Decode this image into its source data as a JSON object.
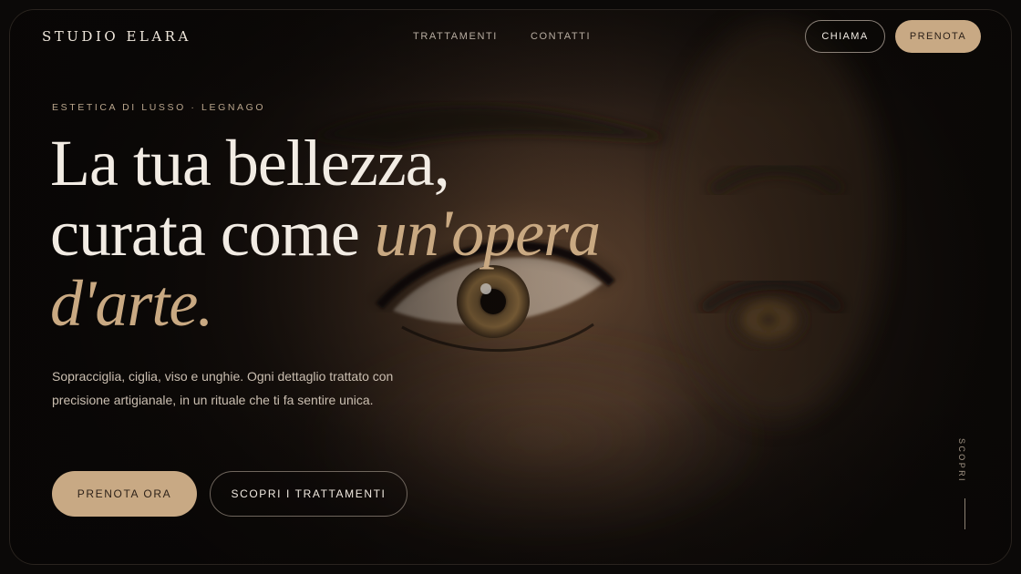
{
  "brand": {
    "name": "STUDIO ELARA"
  },
  "nav": {
    "links": [
      "TRATTAMENTI",
      "CONTATTI"
    ],
    "call_label": "CHIAMA",
    "book_label": "PRENOTA"
  },
  "hero": {
    "eyebrow": "ESTETICA DI LUSSO · LEGNAGO",
    "headline_line1": "La tua bellezza,",
    "headline_line2_plain": "curata come ",
    "headline_line2_accent": "un'opera",
    "headline_line3_accent": "d'arte.",
    "lead": "Sopracciglia, ciglia, viso e unghie. Ogni dettaglio trattato con precisione artigianale, in un rituale che ti fa sentire unica.",
    "cta_primary": "PRENOTA ORA",
    "cta_secondary": "SCOPRI I TRATTAMENTI",
    "scroll_label": "SCOPRI",
    "image_subject": "close-up eye portrait"
  },
  "colors": {
    "accent": "#c8a984",
    "background": "#0b0908",
    "text": "#f2ece4"
  }
}
